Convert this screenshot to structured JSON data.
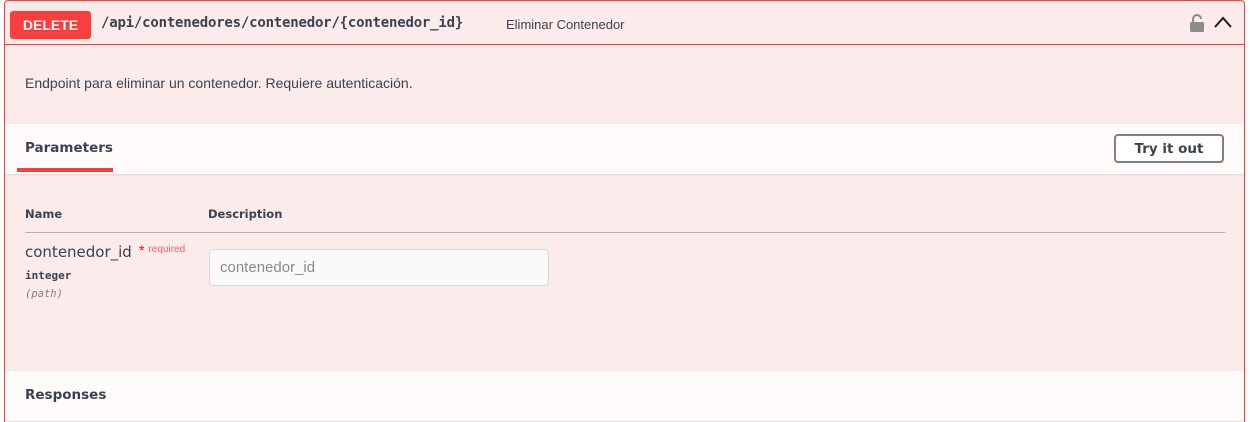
{
  "operation": {
    "method": "DELETE",
    "path": "/api/contenedores/contenedor/{contenedor_id}",
    "summary": "Eliminar Contenedor",
    "description": "Endpoint para eliminar un contenedor. Requiere autenticación."
  },
  "parameters_section": {
    "tab_label": "Parameters",
    "try_button_label": "Try it out",
    "columns": {
      "name": "Name",
      "description": "Description"
    },
    "params": [
      {
        "name": "contenedor_id",
        "required_mark": "*",
        "required_label": "required",
        "type": "integer",
        "in": "(path)",
        "placeholder": "contenedor_id"
      }
    ]
  },
  "responses_section": {
    "title": "Responses"
  },
  "colors": {
    "method_delete": "#f93e3e",
    "block_background": "#fcebeb",
    "text": "#3b4151",
    "required": "#ff0000"
  },
  "icons": {
    "lock": "lock-icon",
    "collapse": "chevron-up-icon"
  }
}
